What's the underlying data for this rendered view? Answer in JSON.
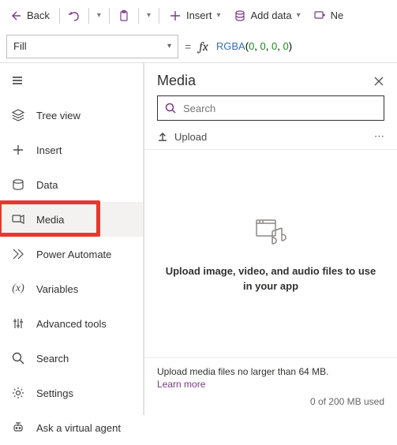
{
  "toolbar": {
    "back": "Back",
    "insert": "Insert",
    "add_data": "Add data",
    "new": "Ne"
  },
  "formula": {
    "property": "Fill",
    "fn": "RGBA",
    "args": [
      "0",
      "0",
      "0",
      "0"
    ]
  },
  "nav": {
    "items": [
      {
        "label": "Tree view",
        "icon": "tree"
      },
      {
        "label": "Insert",
        "icon": "plus"
      },
      {
        "label": "Data",
        "icon": "data"
      },
      {
        "label": "Media",
        "icon": "media"
      },
      {
        "label": "Power Automate",
        "icon": "flow"
      },
      {
        "label": "Variables",
        "icon": "var"
      },
      {
        "label": "Advanced tools",
        "icon": "tools"
      },
      {
        "label": "Search",
        "icon": "search"
      },
      {
        "label": "Settings",
        "icon": "gear"
      },
      {
        "label": "Ask a virtual agent",
        "icon": "agent"
      }
    ],
    "selected_index": 3,
    "highlight_index": 3
  },
  "panel": {
    "title": "Media",
    "search_placeholder": "Search",
    "upload_label": "Upload",
    "empty_text": "Upload image, video, and audio files to use in your app",
    "footer_msg": "Upload media files no larger than 64 MB.",
    "learn_more": "Learn more",
    "usage": "0 of 200 MB used"
  }
}
